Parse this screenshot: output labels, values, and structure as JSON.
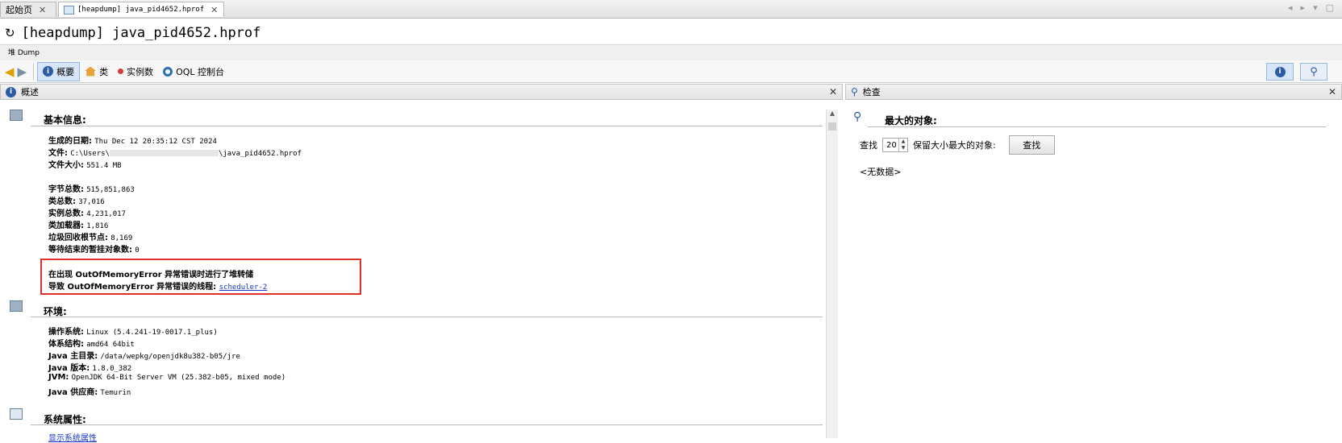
{
  "tabs": [
    {
      "label": "起始页"
    },
    {
      "label": "[heapdump] java_pid4652.hprof"
    }
  ],
  "title": "[heapdump] java_pid4652.hprof",
  "subtab": "堆 Dump",
  "toolbar": {
    "overview": "概要",
    "classes": "类",
    "instances": "实例数",
    "oql": "OQL 控制台"
  },
  "overview_panel": {
    "header": "概述",
    "basic": {
      "title": "基本信息:",
      "generated_label": "生成的日期:",
      "generated_value": "Thu Dec 12 20:35:12 CST 2024",
      "file_label": "文件:",
      "file_value": "C:\\Users\\",
      "file_value_tail": "\\java_pid4652.hprof",
      "size_label": "文件大小:",
      "size_value": "551.4 MB",
      "total_bytes_label": "字节总数:",
      "total_bytes_value": "515,851,863",
      "total_classes_label": "类总数:",
      "total_classes_value": "37,016",
      "total_instances_label": "实例总数:",
      "total_instances_value": "4,231,017",
      "classloaders_label": "类加载器:",
      "classloaders_value": "1,816",
      "gc_roots_label": "垃圾回收根节点:",
      "gc_roots_value": "8,169",
      "pending_final_label": "等待结束的暂挂对象数:",
      "pending_final_value": "0",
      "oom_line1": "在出现 OutOfMemoryError 异常错误时进行了堆转储",
      "oom_line2": "导致 OutOfMemoryError 异常错误的线程:",
      "oom_thread": "scheduler-2"
    },
    "env": {
      "title": "环境:",
      "os_label": "操作系统:",
      "os_value": "Linux (5.4.241-19-0017.1_plus)",
      "arch_label": "体系结构:",
      "arch_value": "amd64 64bit",
      "java_home_label": "Java 主目录:",
      "java_home_value": "/data/wepkg/openjdk8u382-b05/jre",
      "java_version_label": "Java 版本:",
      "java_version_value": "1.8.0_382",
      "jvm_label": "JVM:",
      "jvm_value": "OpenJDK 64-Bit Server VM (25.382-b05, mixed mode)",
      "vendor_label": "Java 供应商:",
      "vendor_value": "Temurin"
    },
    "sysprops": {
      "title": "系统属性:",
      "link": "显示系统属性"
    }
  },
  "inspect_panel": {
    "header": "检查",
    "largest_title": "最大的对象:",
    "find_label": "查找",
    "count_value": "20",
    "retained_label": "保留大小最大的对象:",
    "find_button": "查找",
    "nodata": "<无数据>"
  }
}
